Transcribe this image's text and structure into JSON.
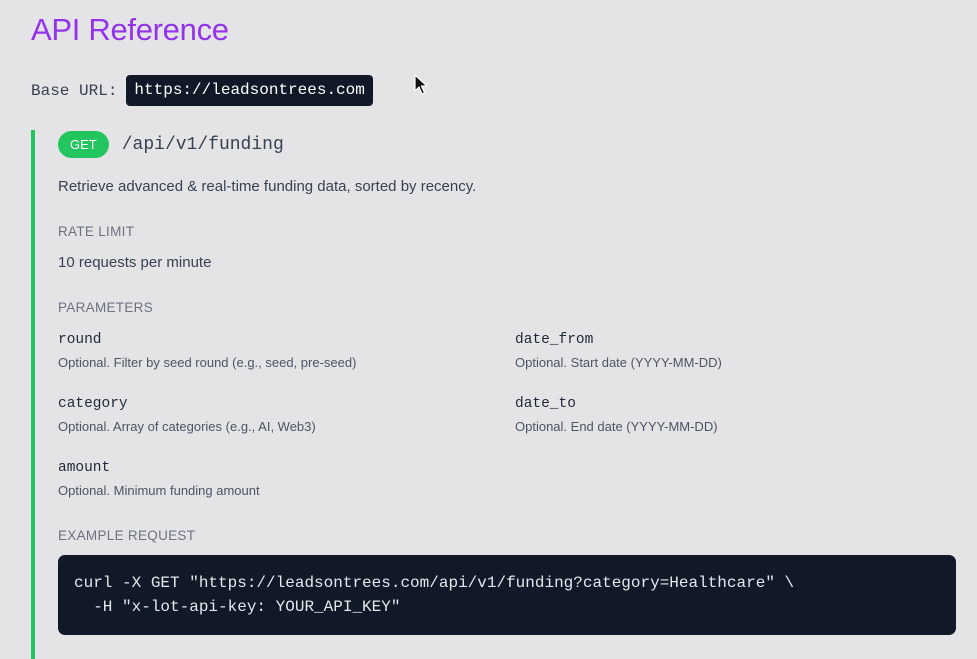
{
  "page": {
    "title": "API Reference",
    "base_url_label": "Base URL:",
    "base_url": "https://leadsontrees.com"
  },
  "endpoint": {
    "method": "GET",
    "path": "/api/v1/funding",
    "description": "Retrieve advanced & real-time funding data, sorted by recency.",
    "rate_limit_label": "RATE LIMIT",
    "rate_limit_value": "10 requests per minute",
    "parameters_label": "PARAMETERS",
    "parameters": [
      {
        "name": "round",
        "description": "Optional. Filter by seed round (e.g., seed, pre-seed)"
      },
      {
        "name": "date_from",
        "description": "Optional. Start date (YYYY-MM-DD)"
      },
      {
        "name": "category",
        "description": "Optional. Array of categories (e.g., AI, Web3)"
      },
      {
        "name": "date_to",
        "description": "Optional. End date (YYYY-MM-DD)"
      },
      {
        "name": "amount",
        "description": "Optional. Minimum funding amount"
      }
    ],
    "example_label": "EXAMPLE REQUEST",
    "example_code": "curl -X GET \"https://leadsontrees.com/api/v1/funding?category=Healthcare\" \\\n  -H \"x-lot-api-key: YOUR_API_KEY\""
  },
  "colors": {
    "accent": "#9333ea",
    "method_get": "#22c55e",
    "code_bg": "#111827",
    "page_bg": "#e4e4e7"
  },
  "icons": {
    "cursor": "mouse-pointer-icon"
  }
}
